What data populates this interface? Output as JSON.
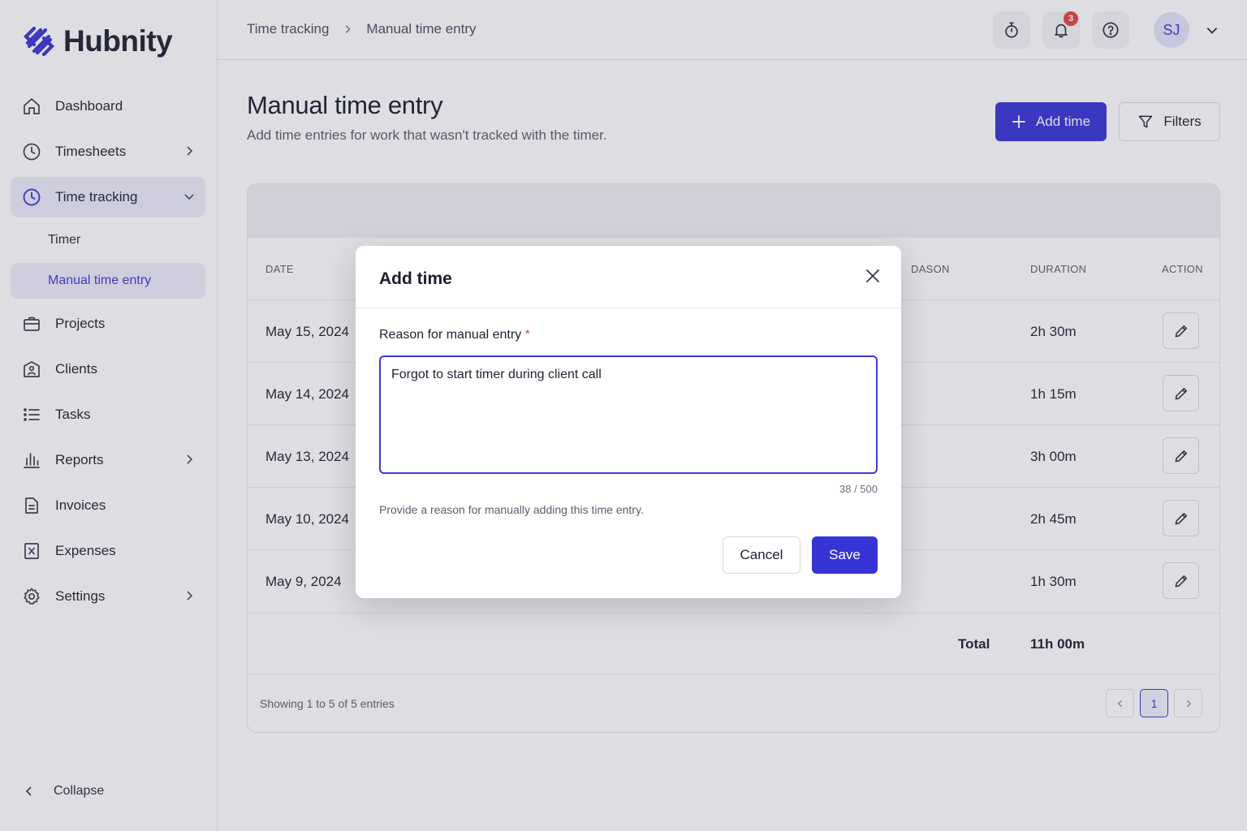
{
  "app": {
    "name": "Hubnity"
  },
  "sidebar": {
    "items": [
      {
        "label": "Dashboard",
        "icon": "home-icon"
      },
      {
        "label": "Timesheets",
        "icon": "clock-icon",
        "has_chevron": true
      },
      {
        "label": "Time tracking",
        "icon": "clock-icon",
        "expanded": true,
        "active": true
      },
      {
        "label": "Projects",
        "icon": "briefcase-icon"
      },
      {
        "label": "Clients",
        "icon": "building-icon"
      },
      {
        "label": "Tasks",
        "icon": "list-icon"
      },
      {
        "label": "Reports",
        "icon": "bar-chart-icon",
        "has_chevron": true
      },
      {
        "label": "Invoices",
        "icon": "document-icon"
      },
      {
        "label": "Expenses",
        "icon": "receipt-icon"
      },
      {
        "label": "Settings",
        "icon": "gear-icon",
        "has_chevron": true
      }
    ],
    "subitems": [
      {
        "label": "Timer"
      },
      {
        "label": "Manual time entry",
        "active": true
      }
    ],
    "collapse_label": "Collapse"
  },
  "topbar": {
    "breadcrumb": [
      "Time tracking",
      "Manual time entry"
    ],
    "notification_count": "3",
    "avatar_initials": "SJ"
  },
  "page": {
    "title": "Manual time entry",
    "subtitle": "Add time entries for work that wasn't tracked with the timer.",
    "add_button": "Add time",
    "filters_button": "Filters"
  },
  "table": {
    "columns": {
      "date": "DATE",
      "reason": "DASON",
      "duration": "DURATION",
      "action": "ACTION"
    },
    "rows": [
      {
        "date": "May 15, 2024",
        "duration": "2h 30m"
      },
      {
        "date": "May 14, 2024",
        "duration": "1h 15m"
      },
      {
        "date": "May 13, 2024",
        "duration": "3h 00m"
      },
      {
        "date": "May 10, 2024",
        "duration": "2h 45m"
      },
      {
        "date": "May 9, 2024",
        "duration": "1h 30m"
      }
    ],
    "total_label": "Total",
    "total_value": "11h 00m",
    "showing": "Showing 1 to 5 of 5 entries",
    "current_page": "1"
  },
  "modal": {
    "title": "Add time",
    "field_label": "Reason for manual entry",
    "required_mark": "*",
    "value": "Forgot to start timer during client call",
    "counter": "38 / 500",
    "helper": "Provide a reason for manually adding this time entry.",
    "cancel": "Cancel",
    "save": "Save"
  },
  "colors": {
    "accent": "#3734d6",
    "badge": "#e0453f",
    "active_bg": "#ebebfa"
  }
}
